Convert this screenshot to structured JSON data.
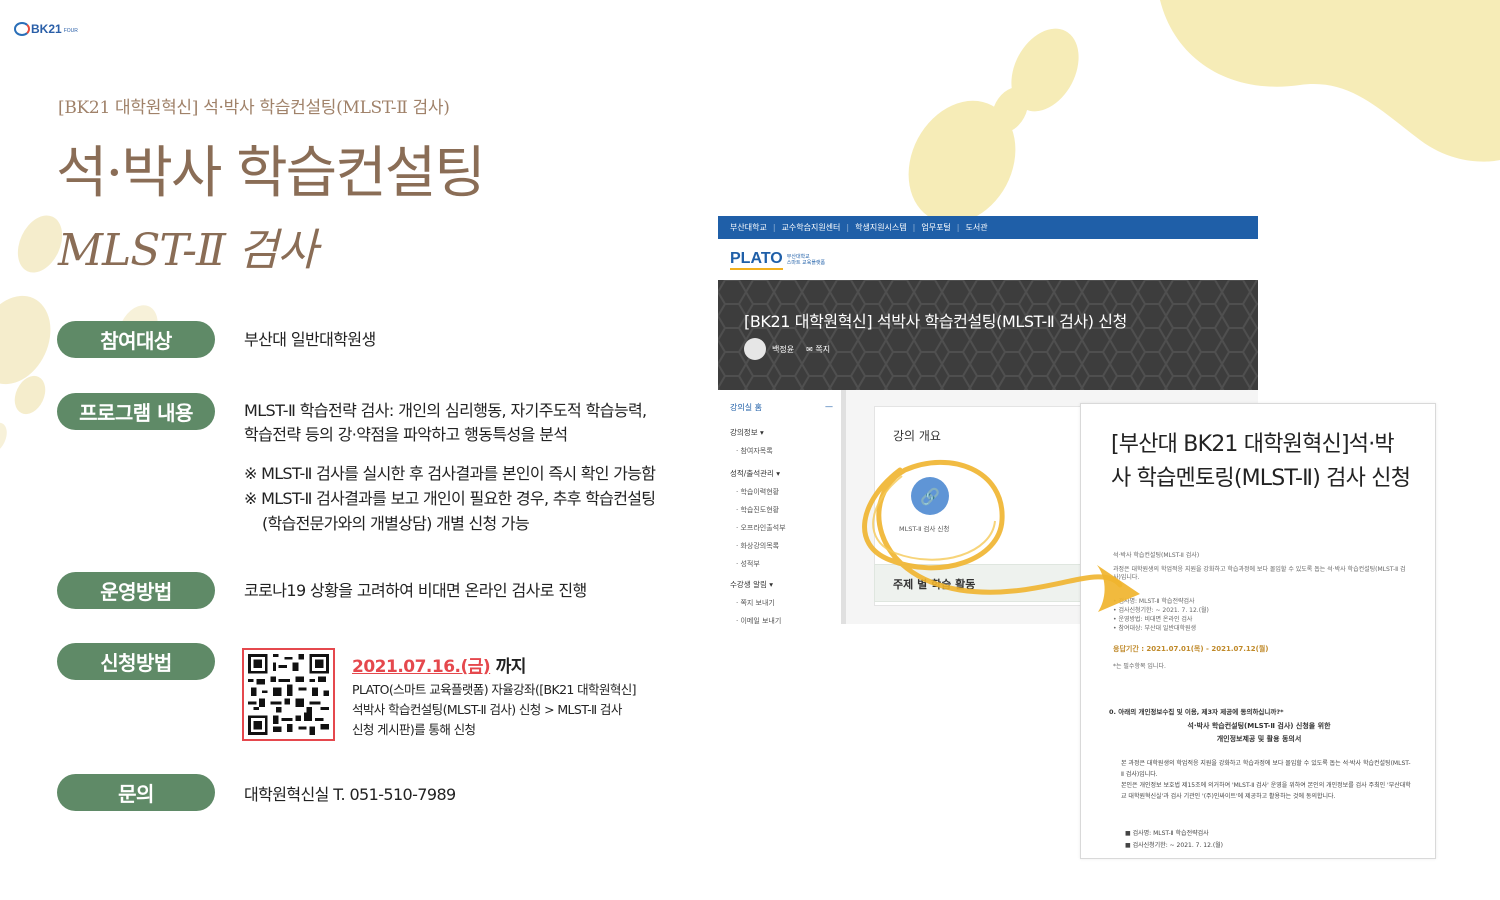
{
  "logo": {
    "text": "BK21",
    "small": "FOUR"
  },
  "header": {
    "subtitle": "[BK21 대학원혁신] 석·박사 학습컨설팅(MLST-Ⅱ 검사)",
    "title": "석·박사 학습컨설팅",
    "title2": "MLST-Ⅱ 검사"
  },
  "sections": {
    "target": {
      "label": "참여대상",
      "text": "부산대 일반대학원생"
    },
    "program": {
      "label": "프로그램 내용",
      "line1": "MLST-Ⅱ 학습전략 검사: 개인의 심리행동, 자기주도적 학습능력,",
      "line2": "학습전략 등의 강·약점을 파악하고 행동특성을 분석",
      "note1": "※ MLST-Ⅱ 검사를 실시한 후 검사결과를 본인이 즉시 확인 가능함",
      "note2a": "※ MLST-Ⅱ 검사결과를 보고 개인이 필요한 경우, 추후 학습컨설팅",
      "note2b": "(학습전문가와의 개별상담) 개별 신청 가능"
    },
    "method": {
      "label": "운영방법",
      "text": "코로나19 상황을 고려하여 비대면 온라인 검사로 진행"
    },
    "apply": {
      "label": "신청방법",
      "date": "2021.07.16.(금)",
      "until": " 까지",
      "line1": "PLATO(스마트 교육플랫폼) 자율강좌([BK21 대학원혁신]",
      "line2": "석박사 학습컨설팅(MLST-Ⅱ 검사) 신청 > MLST-Ⅱ 검사",
      "line3": "신청 게시판)를 통해 신청"
    },
    "contact": {
      "label": "문의",
      "text": "대학원혁신실 T. 051-510-7989"
    }
  },
  "screenshot": {
    "topnav": [
      "부산대학교",
      "교수학습지원센터",
      "학생지원시스템",
      "업무포털",
      "도서관"
    ],
    "brand": "PLATO",
    "brand_sub1": "부산대학교",
    "brand_sub2": "스마트 교육플랫폼",
    "banner_title": "[BK21 대학원혁신] 석박사 학습컨설팅(MLST-Ⅱ 검사) 신청",
    "user": "백정윤",
    "message": "쪽지",
    "side_home": "강의실 홈",
    "side_collapse": "—",
    "side_g1": "강의정보 ▾",
    "side_i1": "· 참여자목록",
    "side_g2": "성적/출석관리 ▾",
    "side_i2": "· 학습이력현황",
    "side_i3": "· 학습진도현황",
    "side_i4": "· 오프라인출석부",
    "side_i5": "· 화상강의목록",
    "side_i6": "· 성적부",
    "side_g3": "수강생 알림 ▾",
    "side_i7": "· 쪽지 보내기",
    "side_i8": "· 이메일 보내기",
    "panel_title": "강의 개요",
    "panel_link": "MLST-Ⅱ 검사 신청",
    "panel2_title": "주제 별 학습 활동"
  },
  "doc": {
    "title": "[부산대 BK21 대학원혁신]석·박사 학습멘토링(MLST-Ⅱ) 검사 신청",
    "s1": "석·박사 학습컨설팅(MLST-Ⅱ 검사)",
    "s2": "과정은 대학원생의 학업적응 지원을 강화하고 학습과정에 보다 몰입할 수 있도록 돕는 석·박사 학습컨설팅(MLST-Ⅱ 검사)입니다.",
    "s3": "• 검사명: MLST-Ⅱ 학습전략검사",
    "s4": "• 검사신청기한: ~ 2021. 7. 12.(월)",
    "s5": "• 운영방법: 비대면 온라인 검사",
    "s6": "• 참여대상: 부산대 일반대학원생",
    "period": "응답기간 : 2021.07.01(목) - 2021.07.12(월)",
    "required": "*는 필수항목 입니다.",
    "agree": "0. 아래의 개인정보수집 및 이용, 제3자 제공에 동의하십니까?*",
    "c1": "석·박사 학습컨설팅(MLST-Ⅱ 검사) 신청을 위한",
    "c2": "개인정보제공 및 활용 동의서",
    "b1": "본 과정은 대학원생의 학업적응 지원을 강화하고 학습과정에 보다 몰입할 수 있도록 돕는 석·박사 학습컨설팅(MLST-Ⅱ 검사)입니다.",
    "b2": "본인은 개인정보 보호법 제15조에 의거하여 'MLST-Ⅱ 검사' 운영을 위하여 본인의 개인정보를 검사 주최인 '부산대학교 대학원혁신실'과 검사 기관인 '(주)인싸이트'에 제공하고 활용하는 것에 동의합니다.",
    "l1": "■ 검사명: MLST-Ⅱ 학습전략검사",
    "l2": "■ 검사신청기한: ~ 2021. 7. 12.(월)"
  },
  "colors": {
    "pill": "#5f8a67",
    "title": "#8a6d56",
    "accent": "#e5484d",
    "yellow": "#f4e7a4",
    "arrow": "#f0b42e"
  }
}
